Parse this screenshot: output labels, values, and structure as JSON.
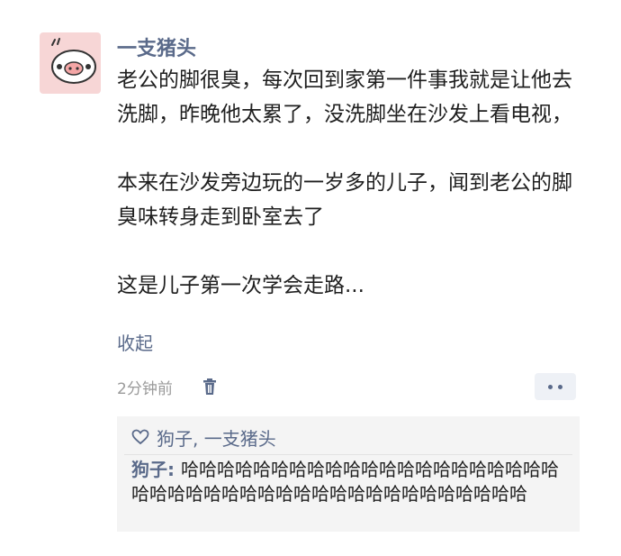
{
  "post": {
    "username": "一支猪头",
    "paragraphs": [
      "老公的脚很臭，每次回到家第一件事我就是让他去洗脚，昨晚他太累了，没洗脚坐在沙发上看电视，",
      "本来在沙发旁边玩的一岁多的儿子，闻到老公的脚臭味转身走到卧室去了",
      "这是儿子第一次学会走路..."
    ],
    "collapse_label": "收起",
    "timestamp": "2分钟前"
  },
  "likes": {
    "names": "狗子, 一支猪头"
  },
  "comment": {
    "author": "狗子",
    "separator": ": ",
    "text": "哈哈哈哈哈哈哈哈哈哈哈哈哈哈哈哈哈哈哈哈哈哈哈哈哈哈哈哈哈哈哈哈哈哈哈哈哈哈哈哈哈哈哈"
  },
  "icons": {
    "avatar": "pig-face-icon",
    "delete": "trash-icon",
    "more": "more-dots-icon",
    "like": "heart-outline-icon"
  },
  "colors": {
    "link": "#5a6a8a",
    "avatar_bg": "#f7d6d6",
    "comment_bg": "#f4f4f4"
  }
}
